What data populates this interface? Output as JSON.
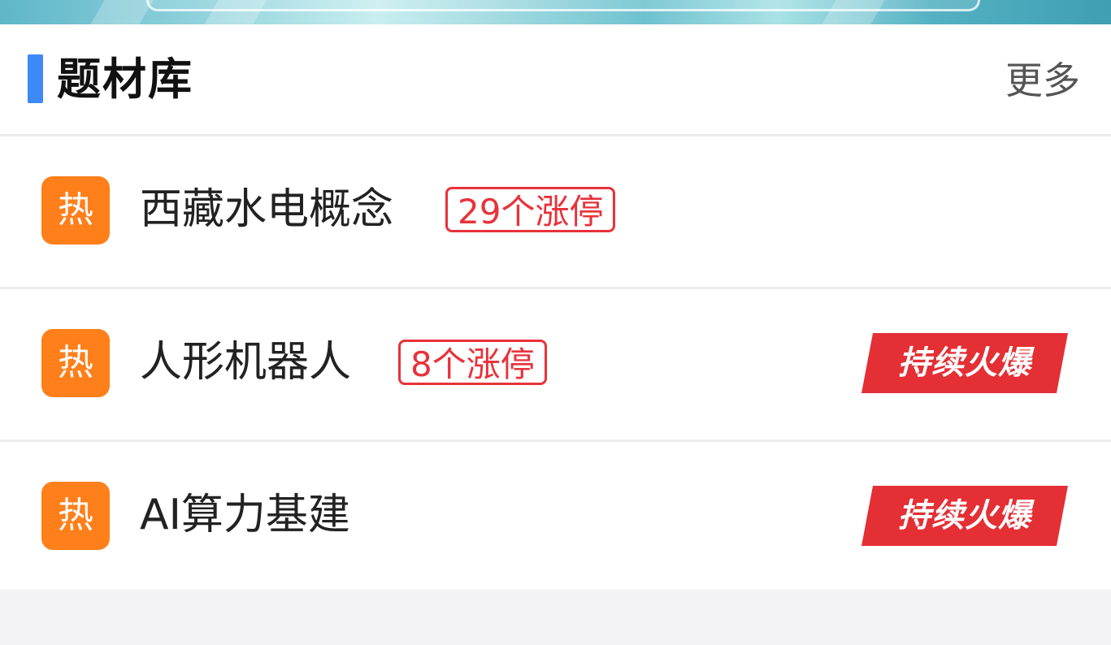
{
  "section": {
    "title": "题材库",
    "more_label": "更多"
  },
  "topics": [
    {
      "hot_label": "热",
      "name": "西藏水电概念",
      "limit_up": "29个涨停",
      "tag": ""
    },
    {
      "hot_label": "热",
      "name": "人形机器人",
      "limit_up": "8个涨停",
      "tag": "持续火爆"
    },
    {
      "hot_label": "热",
      "name": "AI算力基建",
      "limit_up": "",
      "tag": "持续火爆"
    }
  ],
  "colors": {
    "accent": "#3d8af7",
    "hot_icon": "#ff7f1a",
    "limit_red": "#e8323a",
    "tag_red": "#e42f35"
  },
  "icons": {
    "hot": "hot-icon",
    "tag": "fire-tag"
  }
}
